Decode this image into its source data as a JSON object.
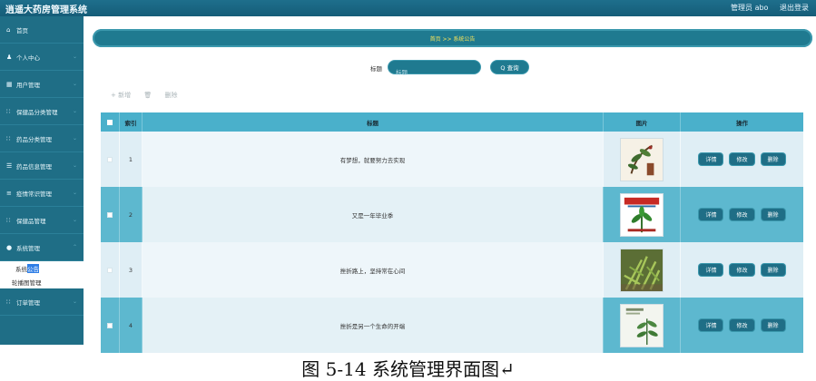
{
  "app": {
    "title": "逍遥大药房管理系统"
  },
  "header": {
    "admin": "管理员 abo",
    "logout": "退出登录"
  },
  "sidebar": {
    "items": [
      {
        "icon": "⌂",
        "label": "首页"
      },
      {
        "icon": "♟",
        "label": "个人中心"
      },
      {
        "icon": "▦",
        "label": "用户管理"
      },
      {
        "icon": "∷",
        "label": "保健品分类管理"
      },
      {
        "icon": "∷",
        "label": "药品分类管理"
      },
      {
        "icon": "☰",
        "label": "药品信息管理"
      },
      {
        "icon": "≡",
        "label": "疫情常识管理"
      },
      {
        "icon": "∷",
        "label": "保健品管理"
      },
      {
        "icon": "●",
        "label": "系统管理"
      }
    ],
    "sub": {
      "notice_part1": "系统",
      "notice_part2": "公告",
      "carousel": "轮播图管理"
    },
    "order": {
      "icon": "∷",
      "label": "订单管理"
    }
  },
  "breadcrumb": "首页 >> 系统公告",
  "search": {
    "label": "标题",
    "placeholder": "标题",
    "button": "Q 查询"
  },
  "actions": {
    "add": "+ 新增",
    "delete": "删除"
  },
  "table": {
    "headers": {
      "index": "索引",
      "title": "标题",
      "image": "图片",
      "ops": "操作"
    },
    "rows": [
      {
        "index": "1",
        "title": "有梦想，就要努力去实现"
      },
      {
        "index": "2",
        "title": "又是一年毕业季"
      },
      {
        "index": "3",
        "title": "挫折路上，坚持常在心间"
      },
      {
        "index": "4",
        "title": "挫折是另一个生命的开端"
      }
    ],
    "ops": {
      "detail": "详情",
      "edit": "修改",
      "delete": "删除"
    }
  },
  "caption": "图 5-14 系统管理界面图↵"
}
